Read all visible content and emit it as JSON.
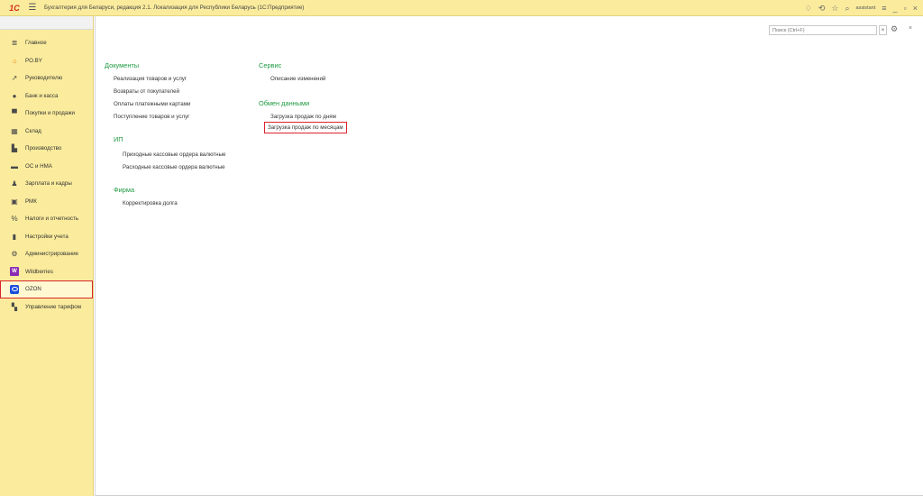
{
  "titlebar": {
    "logo": "1С",
    "menu_icon": "hamburger-icon",
    "title": "Бухгалтерия для Беларуси, редакция 2.1. Локализация для Республики Беларусь  (1С:Предприятие)",
    "user": "assistant",
    "icons": [
      "bell-icon",
      "history-icon",
      "star-icon",
      "search-icon",
      "settings-icon",
      "minimize-icon",
      "maximize-icon",
      "close-icon"
    ]
  },
  "sidebar": {
    "items": [
      {
        "label": "Главное",
        "icon": "menu-lines-icon"
      },
      {
        "label": "PO.BY",
        "icon": "sun-icon"
      },
      {
        "label": "Руководителю",
        "icon": "trend-icon"
      },
      {
        "label": "Банк и касса",
        "icon": "coin-icon"
      },
      {
        "label": "Покупки и продажи",
        "icon": "cart-icon"
      },
      {
        "label": "Склад",
        "icon": "warehouse-icon"
      },
      {
        "label": "Производство",
        "icon": "factory-icon"
      },
      {
        "label": "ОС и НМА",
        "icon": "truck-icon"
      },
      {
        "label": "Зарплата и кадры",
        "icon": "person-icon"
      },
      {
        "label": "РМК",
        "icon": "register-icon"
      },
      {
        "label": "Налоги и отчетность",
        "icon": "percent-icon"
      },
      {
        "label": "Настройки учета",
        "icon": "book-icon"
      },
      {
        "label": "Администрирование",
        "icon": "gear-icon"
      },
      {
        "label": "Wildberries",
        "icon": "wildberries-icon"
      },
      {
        "label": "OZON",
        "icon": "ozon-icon"
      },
      {
        "label": "Управление тарифом",
        "icon": "grid-icon"
      }
    ],
    "selected": "OZON"
  },
  "toolbar": {
    "search_placeholder": "Поиск (Ctrl+F)",
    "clear_label": "×",
    "close_label": "×"
  },
  "sections": {
    "documents": {
      "title": "Документы",
      "links": [
        "Реализация товаров и услуг",
        "Возвраты от покупателей",
        "Оплаты платежными картами",
        "Поступление товаров и услуг"
      ]
    },
    "ip": {
      "title": "ИП",
      "links": [
        "Приходные кассовые ордера валютные",
        "Расходные кассовые ордера валютные"
      ]
    },
    "firma": {
      "title": "Фирма",
      "links": [
        "Корректировка долга"
      ]
    },
    "service": {
      "title": "Сервис",
      "links": [
        "Описание изменений"
      ]
    },
    "exchange": {
      "title": "Обмен данными",
      "links": [
        "Загрузка продаж по дням",
        "Загрузка продаж по месяцам"
      ]
    }
  },
  "colors": {
    "accent_green": "#1f9a41",
    "sidebar_bg": "#fbec9d",
    "highlight_red": "#d9232b"
  }
}
